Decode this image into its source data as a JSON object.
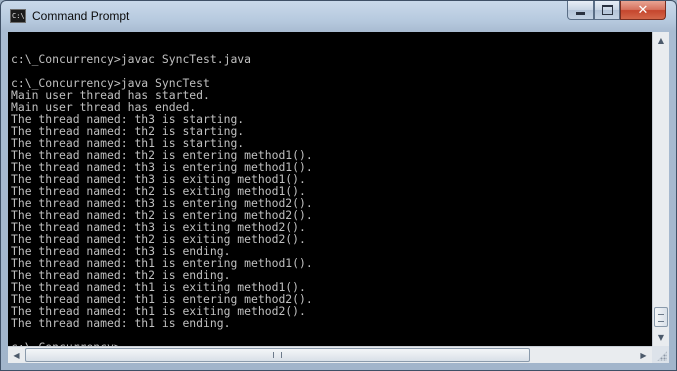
{
  "window": {
    "title": "Command Prompt",
    "icon": "cmd-icon",
    "controls": {
      "minimize": "minimize-icon",
      "maximize": "maximize-icon",
      "close": "close-icon",
      "close_label": "✕"
    }
  },
  "console": {
    "lines": [
      "",
      "c:\\_Concurrency>javac SyncTest.java",
      "",
      "c:\\_Concurrency>java SyncTest",
      "Main user thread has started.",
      "Main user thread has ended.",
      "The thread named: th3 is starting.",
      "The thread named: th2 is starting.",
      "The thread named: th1 is starting.",
      "The thread named: th2 is entering method1().",
      "The thread named: th3 is entering method1().",
      "The thread named: th3 is exiting method1().",
      "The thread named: th2 is exiting method1().",
      "The thread named: th3 is entering method2().",
      "The thread named: th2 is entering method2().",
      "The thread named: th3 is exiting method2().",
      "The thread named: th2 is exiting method2().",
      "The thread named: th3 is ending.",
      "The thread named: th1 is entering method1().",
      "The thread named: th2 is ending.",
      "The thread named: th1 is exiting method1().",
      "The thread named: th1 is entering method2().",
      "The thread named: th1 is exiting method2().",
      "The thread named: th1 is ending.",
      "",
      "c:\\_Concurrency>"
    ],
    "text_color": "#c0c0c0",
    "background_color": "#000000"
  },
  "scrollbars": {
    "vertical": {
      "up_icon": "scroll-up-arrow-icon",
      "down_icon": "scroll-down-arrow-icon",
      "up_glyph": "▲",
      "down_glyph": "▼"
    },
    "horizontal": {
      "left_icon": "scroll-left-arrow-icon",
      "right_icon": "scroll-right-arrow-icon",
      "left_glyph": "◀",
      "right_glyph": "▶"
    }
  },
  "colors": {
    "title_bar": "#b6c9de",
    "close_button": "#c5452d"
  }
}
